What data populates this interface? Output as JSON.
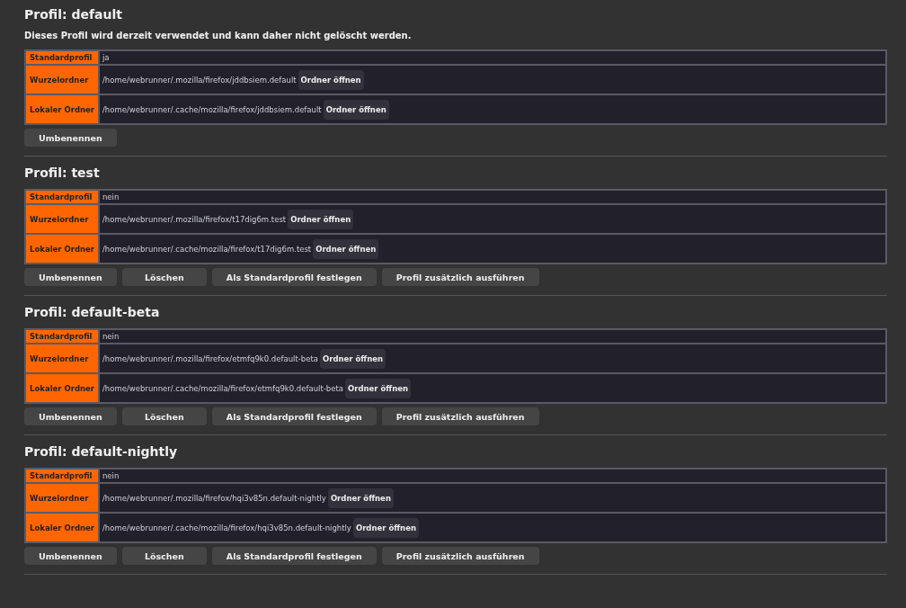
{
  "profiles": [
    {
      "heading": "Profil: default",
      "note": "Dieses Profil wird derzeit verwendet und kann daher nicht gelöscht werden.",
      "rows": [
        {
          "label": "Standardprofil",
          "value": "ja"
        },
        {
          "label": "Wurzelordner",
          "value": "/home/webrunner/.mozilla/firefox/jddbsiem.default",
          "button": "Ordner öffnen"
        },
        {
          "label": "Lokaler Ordner",
          "value": "/home/webrunner/.cache/mozilla/firefox/jddbsiem.default",
          "button": "Ordner öffnen"
        }
      ],
      "buttons": [
        "Umbenennen"
      ]
    },
    {
      "heading": "Profil: test",
      "rows": [
        {
          "label": "Standardprofil",
          "value": "nein"
        },
        {
          "label": "Wurzelordner",
          "value": "/home/webrunner/.mozilla/firefox/t17dig6m.test",
          "button": "Ordner öffnen"
        },
        {
          "label": "Lokaler Ordner",
          "value": "/home/webrunner/.cache/mozilla/firefox/t17dig6m.test",
          "button": "Ordner öffnen"
        }
      ],
      "buttons": [
        "Umbenennen",
        "Löschen",
        "Als Standardprofil festlegen",
        "Profil zusätzlich ausführen"
      ]
    },
    {
      "heading": "Profil: default-beta",
      "rows": [
        {
          "label": "Standardprofil",
          "value": "nein"
        },
        {
          "label": "Wurzelordner",
          "value": "/home/webrunner/.mozilla/firefox/etmfq9k0.default-beta",
          "button": "Ordner öffnen"
        },
        {
          "label": "Lokaler Ordner",
          "value": "/home/webrunner/.cache/mozilla/firefox/etmfq9k0.default-beta",
          "button": "Ordner öffnen"
        }
      ],
      "buttons": [
        "Umbenennen",
        "Löschen",
        "Als Standardprofil festlegen",
        "Profil zusätzlich ausführen"
      ]
    },
    {
      "heading": "Profil: default-nightly",
      "rows": [
        {
          "label": "Standardprofil",
          "value": "nein"
        },
        {
          "label": "Wurzelordner",
          "value": "/home/webrunner/.mozilla/firefox/hqi3v85n.default-nightly",
          "button": "Ordner öffnen"
        },
        {
          "label": "Lokaler Ordner",
          "value": "/home/webrunner/.cache/mozilla/firefox/hqi3v85n.default-nightly",
          "button": "Ordner öffnen"
        }
      ],
      "buttons": [
        "Umbenennen",
        "Löschen",
        "Als Standardprofil festlegen",
        "Profil zusätzlich ausführen"
      ]
    }
  ]
}
